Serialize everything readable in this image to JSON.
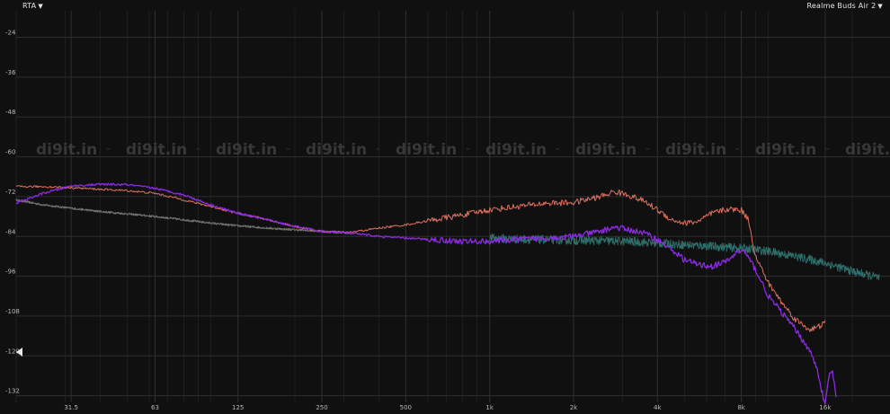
{
  "toolbar": {
    "rta_label": "RTA",
    "device_label": "Realme Buds Air 2",
    "dropdown_icon": "triangle-down-icon"
  },
  "watermark": "di9it.in",
  "colors": {
    "background": "#101010",
    "grid": "#2e2e2e",
    "axis_text": "#b8b8b8",
    "watermark": "#454545"
  },
  "chart_data": {
    "type": "line",
    "title": "",
    "xlabel": "",
    "ylabel": "",
    "xscale": "log",
    "xlim": [
      20,
      25000
    ],
    "ylim": [
      -134,
      -16
    ],
    "x_ticks": [
      {
        "value": 31.5,
        "label": "31.5"
      },
      {
        "value": 63,
        "label": "63"
      },
      {
        "value": 125,
        "label": "125"
      },
      {
        "value": 250,
        "label": "250"
      },
      {
        "value": 500,
        "label": "500"
      },
      {
        "value": 1000,
        "label": "1k"
      },
      {
        "value": 2000,
        "label": "2k"
      },
      {
        "value": 4000,
        "label": "4k"
      },
      {
        "value": 8000,
        "label": "8k"
      },
      {
        "value": 16000,
        "label": "16k"
      }
    ],
    "y_ticks": [
      -24,
      -36,
      -48,
      -60,
      -72,
      -84,
      -96,
      -108,
      -120,
      -132
    ],
    "grid": true,
    "series": [
      {
        "color": "#e07060",
        "x": [
          20,
          25,
          31.5,
          40,
          50,
          63,
          80,
          100,
          125,
          160,
          200,
          250,
          315,
          400,
          500,
          630,
          800,
          1000,
          1250,
          1600,
          2000,
          2500,
          2800,
          3150,
          3600,
          4000,
          4500,
          5000,
          5600,
          6300,
          7100,
          8000,
          8500,
          9000,
          10000,
          11200,
          12500,
          14000,
          15000,
          16000
        ],
        "y": [
          -69,
          -69,
          -69.3,
          -69.8,
          -70.2,
          -71,
          -73,
          -75,
          -77,
          -79,
          -81,
          -82.5,
          -82.8,
          -81.5,
          -80.5,
          -79,
          -77.5,
          -76,
          -75,
          -74,
          -73.8,
          -72,
          -70.5,
          -71.5,
          -73.5,
          -76,
          -79,
          -80,
          -79.5,
          -77,
          -75.8,
          -76,
          -79,
          -90,
          -98,
          -104,
          -109,
          -112,
          -111.5,
          -110
        ]
      },
      {
        "color": "#8a2be2",
        "x": [
          20,
          25,
          31.5,
          40,
          50,
          63,
          80,
          100,
          125,
          160,
          200,
          250,
          315,
          400,
          500,
          630,
          800,
          1000,
          1250,
          1600,
          2000,
          2500,
          2800,
          3150,
          3600,
          4000,
          4500,
          5000,
          5600,
          6300,
          7100,
          7800,
          8200,
          9000,
          10000,
          11200,
          12500,
          14000,
          15000,
          15500,
          16000,
          16500,
          17000,
          17500
        ],
        "y": [
          -74,
          -71,
          -68.8,
          -68.3,
          -68.4,
          -69.5,
          -71.5,
          -74.5,
          -77,
          -79,
          -81,
          -82.5,
          -83,
          -84,
          -84.5,
          -85,
          -85.5,
          -85.5,
          -85,
          -84.5,
          -84,
          -82.5,
          -81.2,
          -82,
          -83,
          -85,
          -88,
          -91,
          -92.5,
          -93,
          -91.5,
          -88.5,
          -88.5,
          -94,
          -102,
          -107,
          -112,
          -118,
          -124,
          -130,
          -135,
          -126,
          -124.5,
          -133
        ]
      },
      {
        "color": "#2e6e6a",
        "x": [
          1000,
          1250,
          1600,
          2000,
          2500,
          3150,
          4000,
          5000,
          6300,
          8000,
          10000,
          12500,
          16000,
          20000,
          25000
        ],
        "y": [
          -84.5,
          -84.8,
          -85,
          -85.2,
          -85.3,
          -85.5,
          -86,
          -86.5,
          -87,
          -87.5,
          -88.5,
          -90,
          -92,
          -94.5,
          -96.5
        ]
      },
      {
        "color": "#8a8a84",
        "x": [
          20,
          25,
          31.5,
          40,
          50,
          63,
          80,
          100,
          125,
          160,
          200,
          250,
          315
        ],
        "y": [
          -73,
          -74.5,
          -75.5,
          -76.5,
          -77.2,
          -78,
          -79,
          -80,
          -80.8,
          -81.5,
          -82,
          -82.5,
          -83
        ]
      }
    ]
  }
}
